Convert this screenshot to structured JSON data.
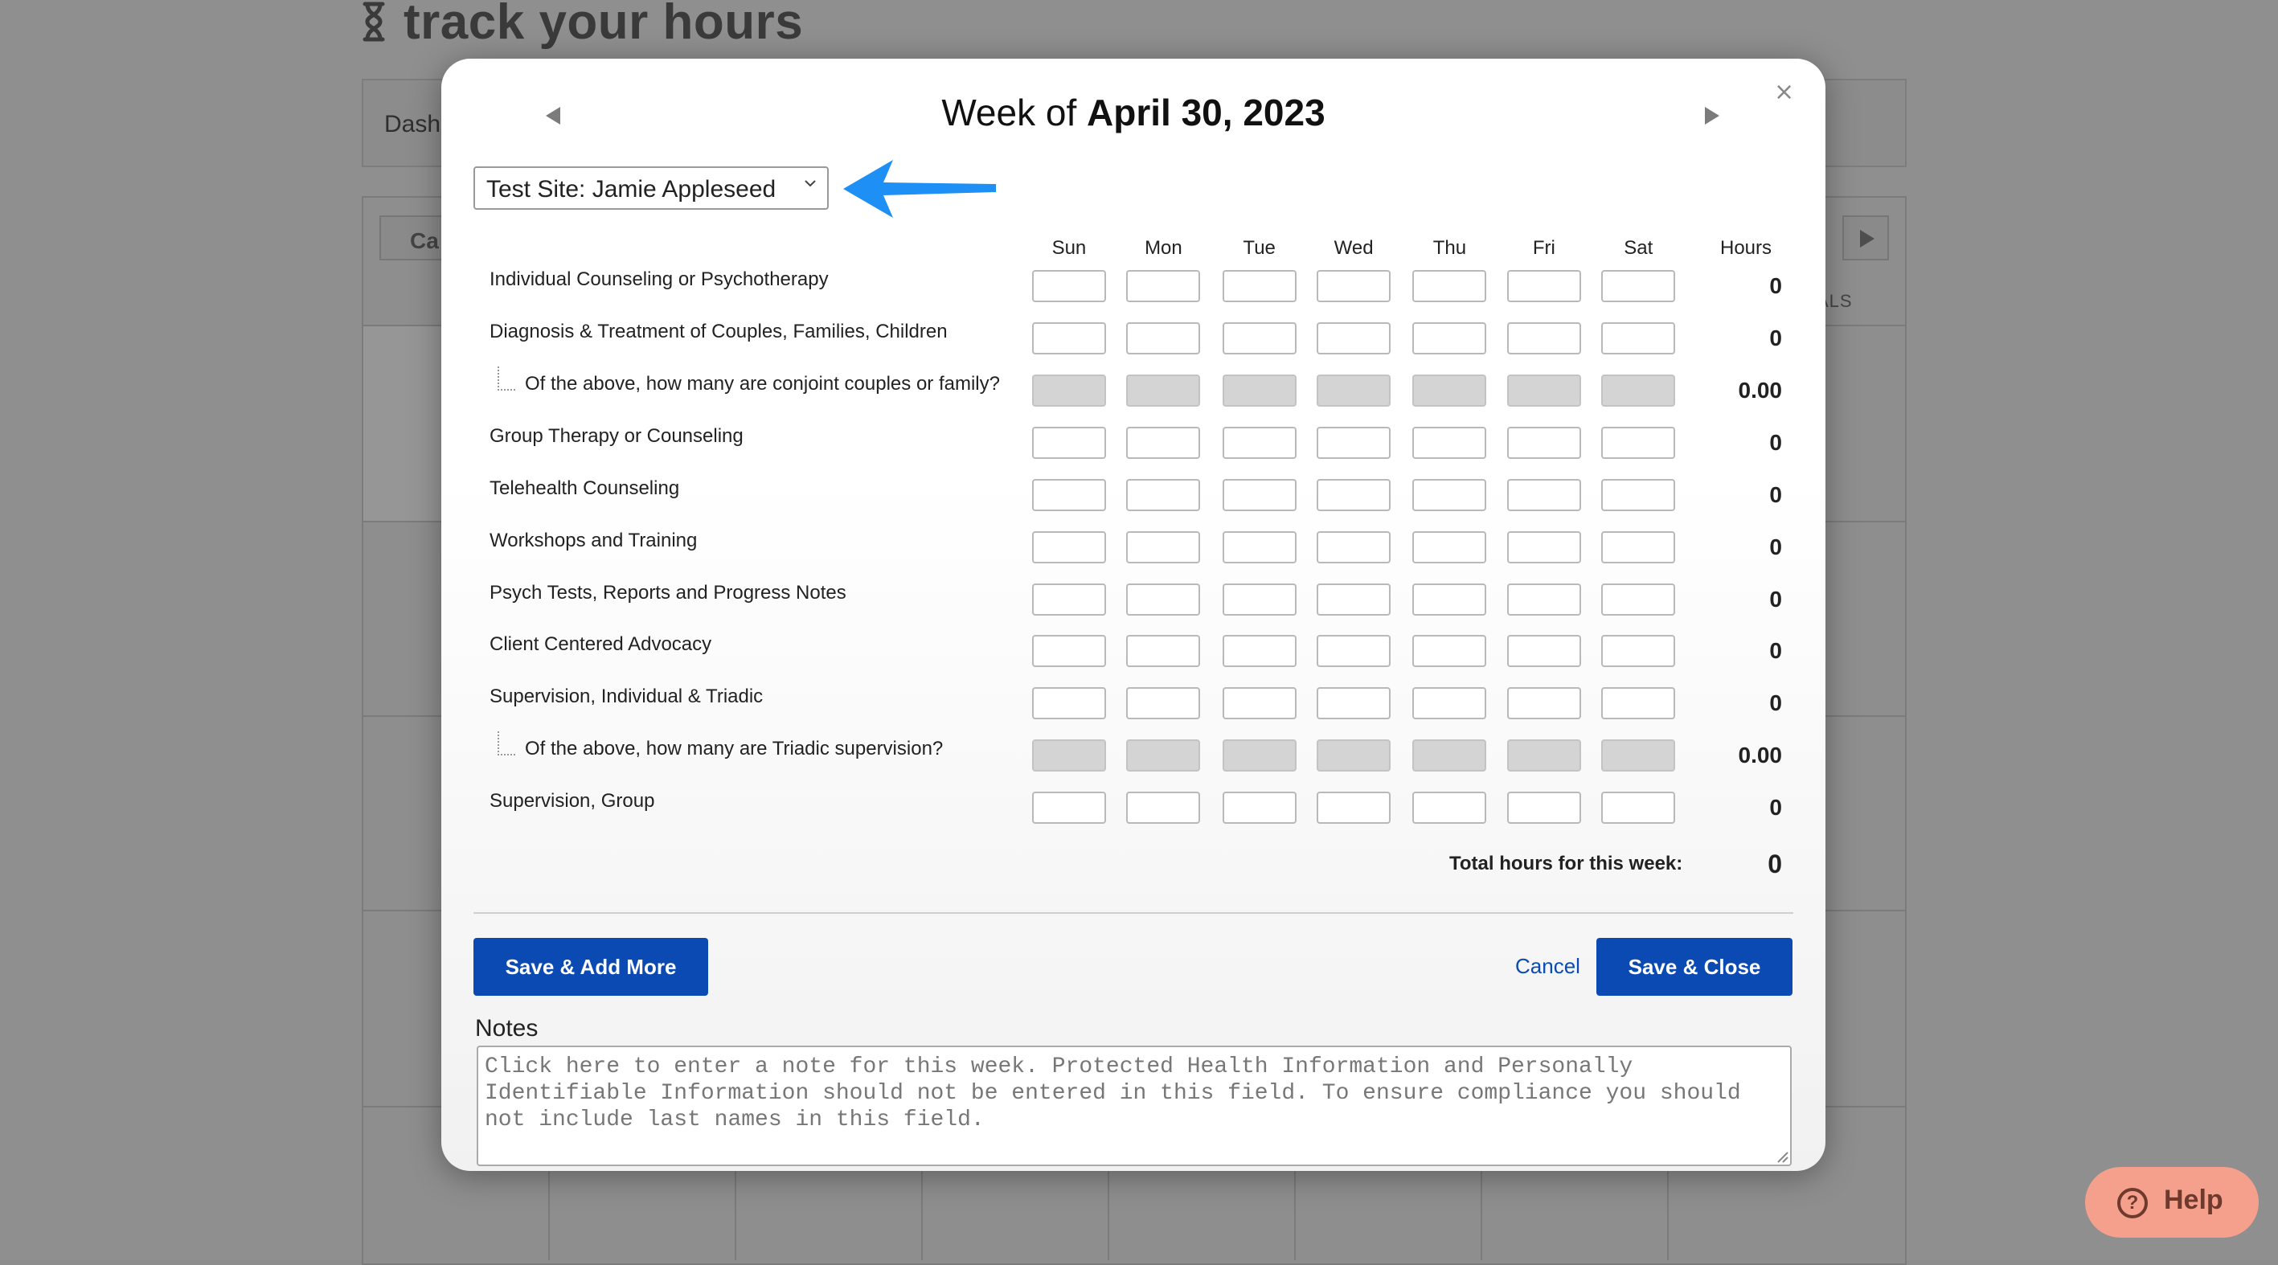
{
  "background": {
    "app_title": "track your hours",
    "nav_label": "Dash",
    "calendar_button": "Ca",
    "totals_header": "ALS"
  },
  "modal": {
    "title_prefix": "Week of",
    "title_date": "April 30, 2023",
    "close_symbol": "×",
    "site_select": {
      "selected": "Test Site: Jamie Appleseed"
    },
    "days": [
      "Sun",
      "Mon",
      "Tue",
      "Wed",
      "Thu",
      "Fri",
      "Sat"
    ],
    "hours_header": "Hours",
    "rows": [
      {
        "label": "Individual Counseling or Psychotherapy",
        "total": "0",
        "sub": false
      },
      {
        "label": "Diagnosis & Treatment of Couples, Families, Children",
        "total": "0",
        "sub": false
      },
      {
        "label": "Of the above, how many are conjoint couples or family?",
        "total": "0.00",
        "sub": true
      },
      {
        "label": "Group Therapy or Counseling",
        "total": "0",
        "sub": false
      },
      {
        "label": "Telehealth Counseling",
        "total": "0",
        "sub": false
      },
      {
        "label": "Workshops and Training",
        "total": "0",
        "sub": false
      },
      {
        "label": "Psych Tests, Reports and Progress Notes",
        "total": "0",
        "sub": false
      },
      {
        "label": "Client Centered Advocacy",
        "total": "0",
        "sub": false
      },
      {
        "label": "Supervision, Individual & Triadic",
        "total": "0",
        "sub": false
      },
      {
        "label": "Of the above, how many are Triadic supervision?",
        "total": "0.00",
        "sub": true
      },
      {
        "label": "Supervision, Group",
        "total": "0",
        "sub": false
      }
    ],
    "total_label": "Total hours for this week:",
    "total_value": "0",
    "buttons": {
      "save_add_more": "Save & Add More",
      "cancel": "Cancel",
      "save_close": "Save & Close"
    },
    "notes": {
      "label": "Notes",
      "placeholder": "Click here to enter a note for this week. Protected Health Information and Personally Identifiable Information should not be entered in this field. To ensure compliance you should not include last names in this field."
    }
  },
  "help": {
    "label": "Help"
  },
  "colors": {
    "primary": "#0b4ab3",
    "annotation_arrow": "#1e90f5",
    "help_bg": "#f4a08c"
  }
}
